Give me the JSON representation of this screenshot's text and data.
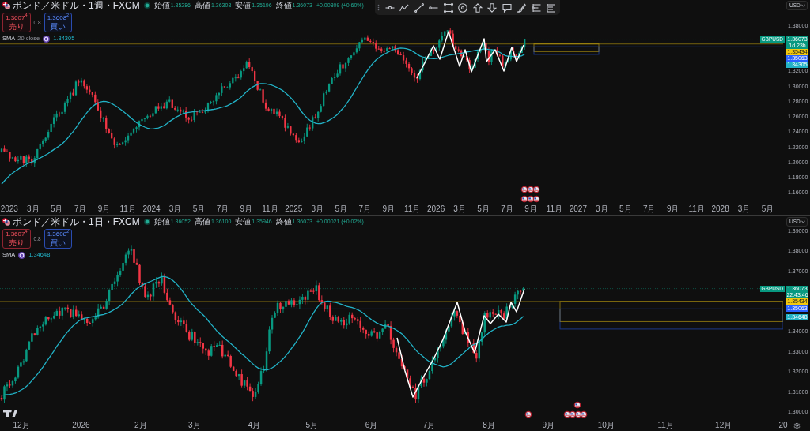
{
  "panes": [
    {
      "title": "ポンド／米ドル・1週・FXCM",
      "ohlc": [
        {
          "label": "始値",
          "value": "1.35286"
        },
        {
          "label": "高値",
          "value": "1.36303"
        },
        {
          "label": "安値",
          "value": "1.35196"
        },
        {
          "label": "終値",
          "value": "1.36073"
        }
      ],
      "change": "+0.00809 (+0.60%)",
      "sell": {
        "price": "1.3607$^{4}$",
        "label": "売り"
      },
      "spread": "0.8",
      "buy": {
        "price": "1.3608$^{2}$",
        "label": "買い"
      },
      "indicator": {
        "name": "SMA",
        "params": "20 close",
        "value": "1.34305"
      },
      "currency": "USD",
      "symbol_tag": "GBPUSD",
      "price_tags": [
        {
          "kind": "last",
          "text": "1.36073",
          "countdown": "1d 23h",
          "color": "#089981"
        },
        {
          "kind": "line",
          "text": "1.35434",
          "color": "#f2c80f"
        },
        {
          "kind": "line",
          "text": "1.35063",
          "color": "#2962ff"
        },
        {
          "kind": "indicator",
          "text": "1.34305",
          "color": "#22b2c6"
        }
      ],
      "price_axis": [
        "1.38000",
        "1.32000",
        "1.30000",
        "1.28000",
        "1.26000",
        "1.24000",
        "1.22000",
        "1.20000",
        "1.18000",
        "1.16000"
      ],
      "time_axis": [
        "2023",
        "3月",
        "5月",
        "7月",
        "9月",
        "11月",
        "2024",
        "3月",
        "5月",
        "7月",
        "9月",
        "11月",
        "2025",
        "3月",
        "5月",
        "7月",
        "9月",
        "11月",
        "2026",
        "3月",
        "5月",
        "7月",
        "9月",
        "11月",
        "2027",
        "3月",
        "5月",
        "7月",
        "9月",
        "11月",
        "2028",
        "3月",
        "5月"
      ]
    },
    {
      "title": "ポンド／米ドル・1日・FXCM",
      "ohlc": [
        {
          "label": "始値",
          "value": "1.36052"
        },
        {
          "label": "高値",
          "value": "1.36100"
        },
        {
          "label": "安値",
          "value": "1.35946"
        },
        {
          "label": "終値",
          "value": "1.36073"
        }
      ],
      "change": "+0.00021 (+0.02%)",
      "sell": {
        "price": "1.3607$^{4}$",
        "label": "売り"
      },
      "spread": "0.8",
      "buy": {
        "price": "1.3608$^{2}$",
        "label": "買い"
      },
      "indicator": {
        "name": "SMA",
        "value": "1.34648"
      },
      "currency": "USD",
      "symbol_tag": "GBPUSD",
      "price_tags": [
        {
          "kind": "last",
          "text": "1.36073",
          "countdown": "22:43:46",
          "color": "#089981"
        },
        {
          "kind": "line",
          "text": "1.35434",
          "color": "#f2c80f"
        },
        {
          "kind": "line",
          "text": "1.35063",
          "color": "#2962ff"
        },
        {
          "kind": "indicator",
          "text": "1.34648",
          "color": "#22b2c6"
        }
      ],
      "price_axis": [
        "1.39000",
        "1.38000",
        "1.37000",
        "1.34000",
        "1.33000",
        "1.32000",
        "1.31000",
        "1.30000"
      ],
      "time_axis": [
        "12月",
        "2026",
        "2月",
        "3月",
        "4月",
        "5月",
        "6月",
        "7月",
        "8月",
        "9月",
        "10月",
        "11月",
        "12月",
        "20"
      ]
    }
  ]
}
